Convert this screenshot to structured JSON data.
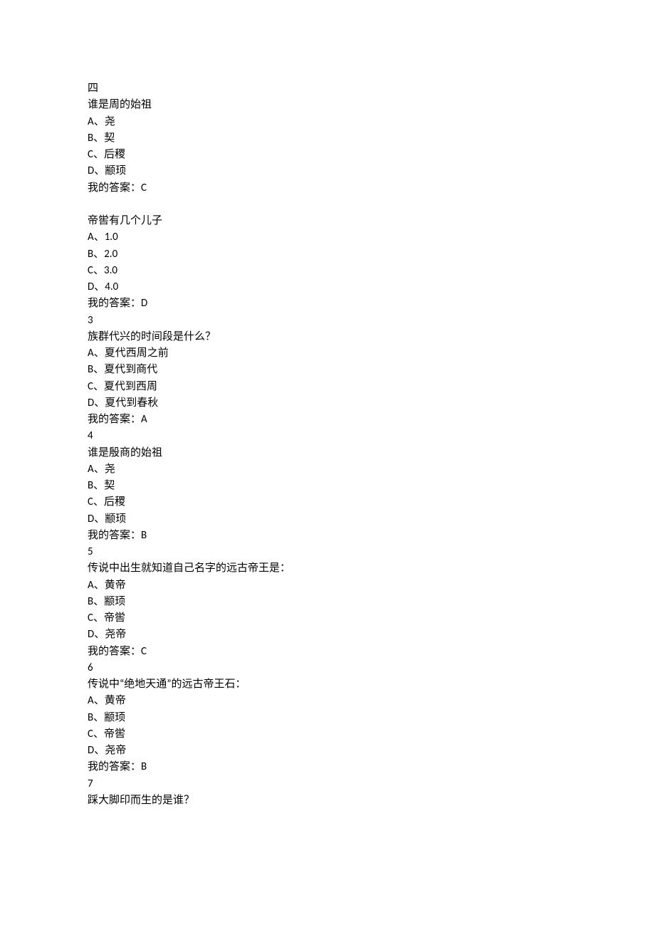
{
  "section_label": "四",
  "questions": [
    {
      "number": "",
      "text": "谁是周的始祖",
      "options": [
        {
          "letter": "A",
          "value": "尧"
        },
        {
          "letter": "B",
          "value": "契"
        },
        {
          "letter": "C",
          "value": "后稷"
        },
        {
          "letter": "D",
          "value": "颛顼"
        }
      ],
      "answer_label": "我的答案：",
      "answer": "C"
    },
    {
      "number": "",
      "text": "帝喾有几个儿子",
      "options": [
        {
          "letter": "A",
          "value": "1.0"
        },
        {
          "letter": "B",
          "value": "2.0"
        },
        {
          "letter": "C",
          "value": "3.0"
        },
        {
          "letter": "D",
          "value": "4.0"
        }
      ],
      "answer_label": "我的答案：",
      "answer": "D"
    },
    {
      "number": "3",
      "text": "族群代兴的时间段是什么？",
      "options": [
        {
          "letter": "A",
          "value": "夏代西周之前"
        },
        {
          "letter": "B",
          "value": "夏代到商代"
        },
        {
          "letter": "C",
          "value": "夏代到西周"
        },
        {
          "letter": "D",
          "value": "夏代到春秋"
        }
      ],
      "answer_label": "我的答案：",
      "answer": "A"
    },
    {
      "number": "4",
      "text": "谁是殷商的始祖",
      "options": [
        {
          "letter": "A",
          "value": "尧"
        },
        {
          "letter": "B",
          "value": "契"
        },
        {
          "letter": "C",
          "value": "后稷"
        },
        {
          "letter": "D",
          "value": "颛顼"
        }
      ],
      "answer_label": "我的答案：",
      "answer": "B"
    },
    {
      "number": "5",
      "text": "传说中出生就知道自己名字的远古帝王是：",
      "options": [
        {
          "letter": "A",
          "value": "黄帝"
        },
        {
          "letter": "B",
          "value": "颛顼"
        },
        {
          "letter": "C",
          "value": "帝喾"
        },
        {
          "letter": "D",
          "value": "尧帝"
        }
      ],
      "answer_label": "我的答案：",
      "answer": "C"
    },
    {
      "number": "6",
      "text": "传说中“绝地天通”的远古帝王石：",
      "options": [
        {
          "letter": "A",
          "value": "黄帝"
        },
        {
          "letter": "B",
          "value": "颛顼"
        },
        {
          "letter": "C",
          "value": "帝喾"
        },
        {
          "letter": "D",
          "value": "尧帝"
        }
      ],
      "answer_label": "我的答案：",
      "answer": "B"
    },
    {
      "number": "7",
      "text": "踩大脚印而生的是谁？",
      "options": [],
      "answer_label": "",
      "answer": ""
    }
  ],
  "option_sep": "、"
}
